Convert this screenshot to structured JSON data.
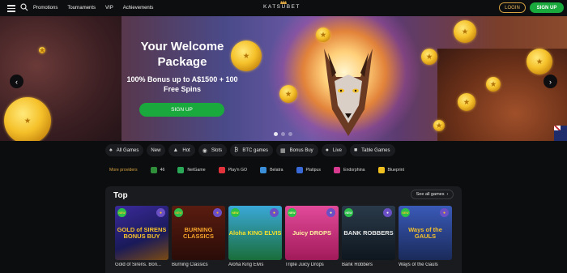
{
  "nav": {
    "promotions": "Promotions",
    "tournaments": "Tournaments",
    "vip": "VIP",
    "achievements": "Achievements"
  },
  "brand": {
    "logo": "KATSUBET",
    "accent": "#1aa93c",
    "gold": "#d9a441"
  },
  "auth": {
    "login": "LOGIN",
    "signup": "SIGN UP"
  },
  "hero": {
    "title": "Your Welcome Package",
    "subtitle": "100% Bonus up to A$1500 + 100 Free Spins",
    "cta": "SIGN UP",
    "prev_icon": "chevron-left-icon",
    "next_icon": "chevron-right-icon"
  },
  "categories": [
    {
      "label": "All Games",
      "icon": "cards-icon"
    },
    {
      "label": "New",
      "icon": ""
    },
    {
      "label": "Hot",
      "icon": "fire-icon"
    },
    {
      "label": "Slots",
      "icon": "slots-icon"
    },
    {
      "label": "BTC games",
      "icon": "btc-icon"
    },
    {
      "label": "Bonus Buy",
      "icon": "bonus-icon"
    },
    {
      "label": "Live",
      "icon": "live-icon"
    },
    {
      "label": "Table Games",
      "icon": "table-icon"
    }
  ],
  "providers": {
    "more": "More providers",
    "items": [
      {
        "label": "46",
        "color": "#2f8f3a"
      },
      {
        "label": "NetGame",
        "color": "#2aa858"
      },
      {
        "label": "Play'n GO",
        "color": "#e2323c"
      },
      {
        "label": "Belatra",
        "color": "#3a8fd8"
      },
      {
        "label": "Platipus",
        "color": "#3a6ad8"
      },
      {
        "label": "Endorphina",
        "color": "#d83a8f"
      },
      {
        "label": "Blueprint",
        "color": "#f0c020"
      }
    ]
  },
  "top": {
    "title": "Top",
    "see_all": "See all games",
    "games": [
      {
        "name": "Gold of Sirens. Bon...",
        "art": "GOLD of SIRENS BONUS BUY",
        "bg": "#2a2a7a",
        "new": "NEW",
        "pp": "●"
      },
      {
        "name": "Burning Classics",
        "art": "BURNING CLASSICS",
        "bg": "#3a1410",
        "new": "NEW",
        "pp": "●"
      },
      {
        "name": "Aloha King Elvis",
        "art": "Aloha KING ELVIS",
        "bg": "#1e6ea8",
        "new": "NEW",
        "pp": "●"
      },
      {
        "name": "Triple Juicy Drops",
        "art": "Juicy DROPS",
        "bg": "#c22a7a",
        "new": "NEW",
        "pp": "●"
      },
      {
        "name": "Bank Robbers",
        "art": "BANK ROBBERS",
        "bg": "#1a2a3a",
        "new": "NEW",
        "pp": "●"
      },
      {
        "name": "Ways of the Gauls",
        "art": "Ways of the GAULS",
        "bg": "#2a4a8a",
        "new": "NEW",
        "pp": "●"
      }
    ]
  }
}
